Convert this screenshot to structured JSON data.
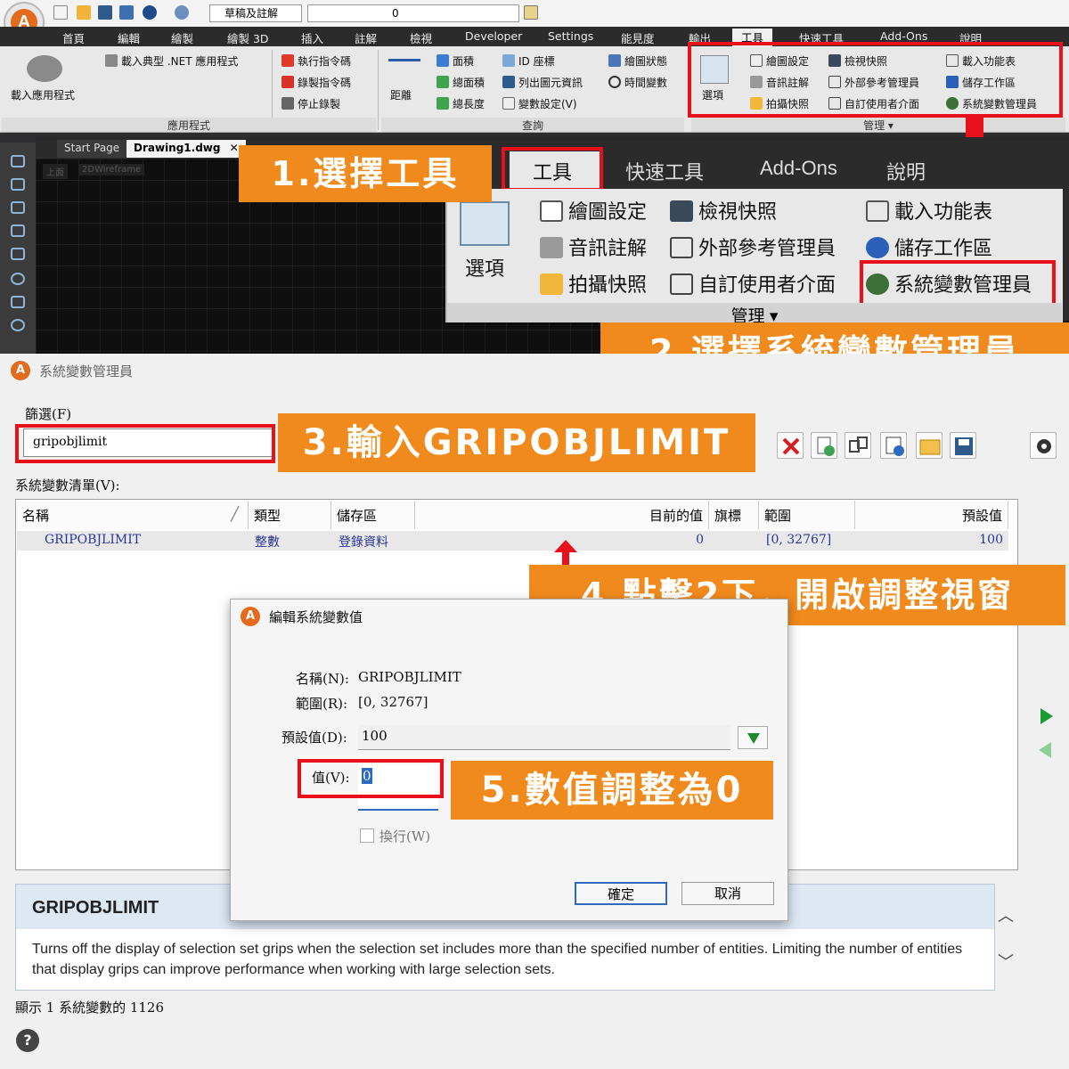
{
  "qat": {
    "drop1": "草稿及註解",
    "layer": "0"
  },
  "menus": [
    "首頁",
    "編輯",
    "繪製",
    "繪製 3D",
    "插入",
    "註解",
    "檢視",
    "Developer",
    "Settings",
    "能見度",
    "輸出",
    "工具",
    "快速工具",
    "Add-Ons",
    "說明"
  ],
  "ribbon": {
    "load_app": "載入應用程式",
    "load_typical": "載入典型 .NET 應用程式",
    "run_macro": "執行指令碼",
    "record_macro": "錄製指令碼",
    "stop_record": "停止錄製",
    "group_app": "應用程式",
    "distance": "距離",
    "area": "面積",
    "id_point": "ID 座標",
    "draw_status": "繪圖狀態",
    "total_area": "總面積",
    "list_entity": "列出圖元資訊",
    "time_var": "時間變數",
    "total_length": "總長度",
    "var_setting": "變數設定(V)",
    "group_query": "查詢",
    "options": "選項",
    "draw_settings": "繪圖設定",
    "view_snapshot": "檢視快照",
    "load_menu": "載入功能表",
    "audio_note": "音訊註解",
    "xref_manager": "外部參考管理員",
    "save_workspace": "儲存工作區",
    "take_snapshot": "拍攝快照",
    "custom_ui": "自訂使用者介面",
    "sysvar_manager": "系統變數管理員",
    "group_manage": "管理 ▾"
  },
  "doc_tabs": {
    "start": "Start Page",
    "drawing": "Drawing1.dwg",
    "close": "✕",
    "vp1": "上面",
    "vp2": "2DWireframe"
  },
  "zoom": {
    "tabs": [
      "工具",
      "快速工具",
      "Add-Ons",
      "說明"
    ],
    "group": "管理 ▾"
  },
  "callouts": {
    "step1": "1.選擇工具",
    "step2": "2.選擇系統變數管理員",
    "step3": "3.輸入GRIPOBJLIMIT",
    "step4": "4.點擊2下，開啟調整視窗",
    "step5": "5.數值調整為0"
  },
  "dialog": {
    "title": "系統變數管理員",
    "filter_label": "篩選(F)",
    "filter_value": "gripobjlimit",
    "list_label": "系統變數清單(V):",
    "columns": [
      "名稱",
      "類型",
      "儲存區",
      "目前的值",
      "旗標",
      "範圍",
      "預設值"
    ],
    "row": {
      "name": "GRIPOBJLIMIT",
      "type": "整數",
      "storage": "登錄資料",
      "current": "0",
      "flag": "",
      "range": "[0, 32767]",
      "default": "100"
    },
    "status": "顯示 1 系統變數的 1126",
    "help_title": "GRIPOBJLIMIT",
    "help_text": "Turns off the display of selection set grips when the selection set includes more than the specified number of entities. Limiting the number of entities that display grips can improve performance when working with large selection sets.",
    "help_icon": "?"
  },
  "modal": {
    "title": "編輯系統變數值",
    "name_label": "名稱(N):",
    "name_value": "GRIPOBJLIMIT",
    "range_label": "範圍(R):",
    "range_value": "[0, 32767]",
    "default_label": "預設值(D):",
    "default_value": "100",
    "value_label": "值(V):",
    "value": "0",
    "wrap_label": "換行(W)",
    "ok": "確定",
    "cancel": "取消"
  },
  "colors": {
    "accent": "#f18a1c",
    "highlight": "#e8101b",
    "link": "#2b3596"
  }
}
